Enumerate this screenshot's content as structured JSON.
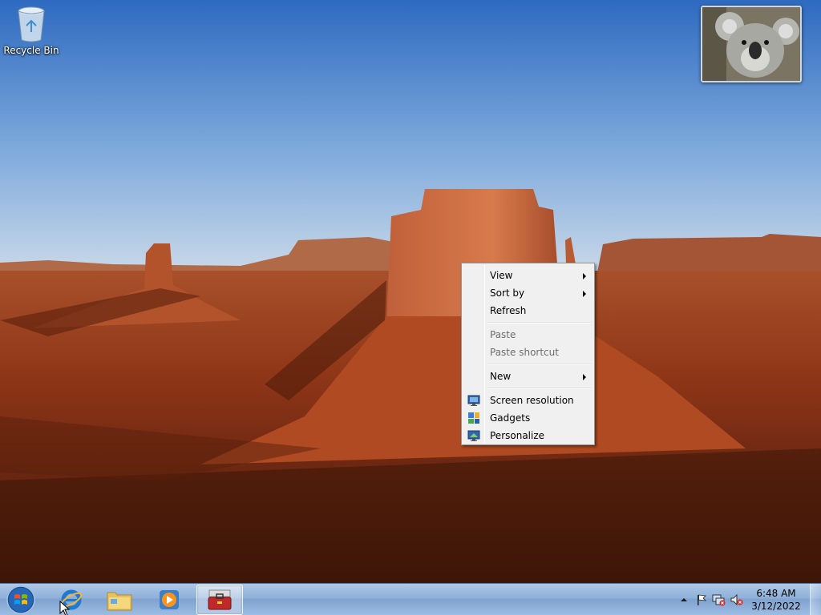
{
  "desktop": {
    "icons": [
      {
        "label": "Recycle Bin",
        "icon": "recycle-bin-icon"
      }
    ],
    "gadget": {
      "name": "slideshow-gadget",
      "subject": "koala"
    }
  },
  "context_menu": {
    "items": [
      {
        "label": "View",
        "submenu": true,
        "enabled": true
      },
      {
        "label": "Sort by",
        "submenu": true,
        "enabled": true
      },
      {
        "label": "Refresh",
        "submenu": false,
        "enabled": true
      },
      {
        "label": "Paste",
        "submenu": false,
        "enabled": false
      },
      {
        "label": "Paste shortcut",
        "submenu": false,
        "enabled": false
      },
      {
        "label": "New",
        "submenu": true,
        "enabled": true
      },
      {
        "label": "Screen resolution",
        "submenu": false,
        "enabled": true,
        "icon": "screen-resolution-icon"
      },
      {
        "label": "Gadgets",
        "submenu": false,
        "enabled": true,
        "icon": "gadgets-icon"
      },
      {
        "label": "Personalize",
        "submenu": false,
        "enabled": true,
        "icon": "personalize-icon"
      }
    ]
  },
  "taskbar": {
    "start": {
      "icon": "windows-start-icon"
    },
    "pinned": [
      {
        "name": "Internet Explorer",
        "icon": "internet-explorer-icon"
      },
      {
        "name": "Windows Explorer",
        "icon": "folder-icon"
      },
      {
        "name": "Windows Media Player",
        "icon": "media-player-icon"
      },
      {
        "name": "Toolbox",
        "icon": "toolbox-icon",
        "active": true
      }
    ],
    "tray": {
      "icons": [
        "show-hidden-icons-arrow",
        "action-center-flag-icon",
        "network-icon",
        "volume-muted-icon"
      ],
      "time": "6:48 AM",
      "date": "3/12/2022"
    }
  },
  "colors": {
    "taskbar": "#8fb0d8",
    "menu_bg": "#f0f0f0",
    "menu_disabled": "#6d6d6d"
  }
}
